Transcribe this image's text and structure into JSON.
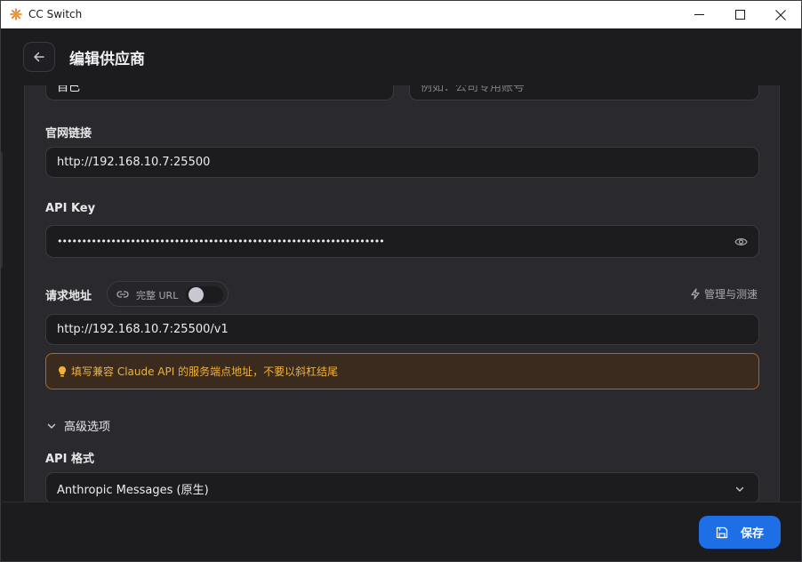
{
  "window": {
    "title": "CC Switch"
  },
  "header": {
    "title": "编辑供应商"
  },
  "fields": {
    "name_value": "自己",
    "note_placeholder": "例如：公司专用账号",
    "website_label": "官网链接",
    "website_value": "http://192.168.10.7:25500",
    "apikey_label": "API Key",
    "apikey_value": "•••••••••••••••••••••••••••••••••••••••••••••••••••••••••••••••••••",
    "endpoint_label": "请求地址",
    "full_url_label": "完整 URL",
    "full_url_enabled": false,
    "manage_label": "管理与测速",
    "endpoint_value": "http://192.168.10.7:25500/v1",
    "hint_text": "填写兼容 Claude API 的服务端点地址，不要以斜杠结尾",
    "advanced_label": "高级选项",
    "api_format_label": "API 格式",
    "api_format_value": "Anthropic Messages (原生)"
  },
  "footer": {
    "save_label": "保存"
  },
  "colors": {
    "accent": "#1e6fe6",
    "warning_text": "#f0b23a",
    "warning_border": "#b8621a",
    "panel_bg": "#2a2a2e",
    "window_bg": "#1c1c1f"
  }
}
